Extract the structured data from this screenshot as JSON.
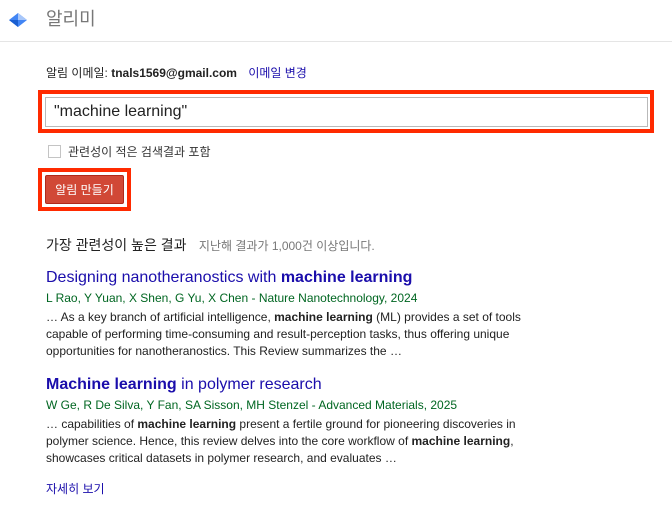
{
  "header": {
    "app_title": "알리미",
    "logo_icon": "scholar-logo-icon"
  },
  "alert_form": {
    "email_label": "알림 이메일: ",
    "email_value": "tnals1569@gmail.com",
    "change_email_label": "이메일 변경",
    "query_value": "\"machine learning\"",
    "checkbox_label": "관련성이 적은 검색결과 포함",
    "checkbox_checked": false,
    "create_button_label": "알림 만들기"
  },
  "results": {
    "title": "가장 관련성이 높은 결과",
    "count_text": "지난해 결과가 1,000건 이상입니다.",
    "items": [
      {
        "title_pre": "Designing nanotheranostics with ",
        "title_bold": "machine learning",
        "title_post": "",
        "authors": "L Rao, Y Yuan, X Shen, G Yu, X Chen - Nature Nanotechnology, 2024",
        "snippet_1": "… As a key branch of artificial intelligence, ",
        "snippet_bold_1": "machine learning",
        "snippet_2": " (ML) provides a set of tools capable of performing time-consuming and result-perception tasks, thus offering unique opportunities for nanotheranostics. This Review summarizes the …"
      },
      {
        "title_pre": "",
        "title_bold": "Machine learning",
        "title_post": " in polymer research",
        "authors": "W Ge, R De Silva, Y Fan, SA Sisson, MH Stenzel - Advanced Materials, 2025",
        "snippet_1": "… capabilities of ",
        "snippet_bold_1": "machine learning",
        "snippet_2": " present a fertile ground for pioneering discoveries in polymer science. Hence, this review delves into the core workflow of ",
        "snippet_bold_2": "machine learning",
        "snippet_3": ", showcases critical datasets in polymer research, and evaluates …"
      }
    ],
    "more_label": "자세히 보기"
  },
  "colors": {
    "accent_red": "#d14836",
    "highlight_red": "#ff2a00",
    "link_blue": "#1a0dab",
    "author_green": "#006621"
  }
}
